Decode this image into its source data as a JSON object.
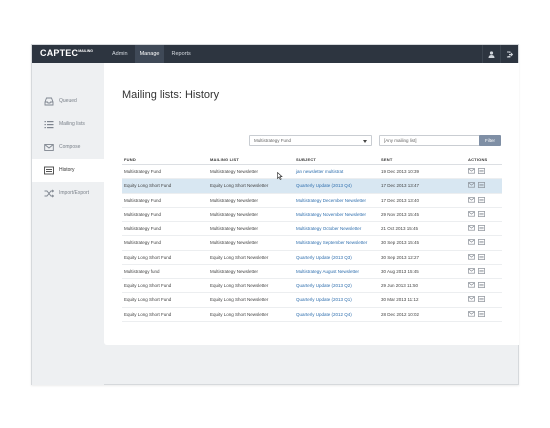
{
  "app": {
    "logo": "CAPTEC",
    "logo_sub": "MAILING"
  },
  "topnav": [
    {
      "label": "Admin",
      "active": false
    },
    {
      "label": "Manage",
      "active": true
    },
    {
      "label": "Reports",
      "active": false
    }
  ],
  "sidebar": {
    "items": [
      {
        "label": "Queued",
        "icon": "inbox-tray-icon",
        "active": false
      },
      {
        "label": "Mailing lists",
        "icon": "list-icon",
        "active": false
      },
      {
        "label": "Compose",
        "icon": "envelope-icon",
        "active": false
      },
      {
        "label": "History",
        "icon": "history-list-icon",
        "active": true
      },
      {
        "label": "Import/Export",
        "icon": "shuffle-icon",
        "active": false
      }
    ]
  },
  "page": {
    "title": "Mailing lists: History"
  },
  "filters": {
    "fund_select": "Multistrategy Fund",
    "list_select": "[Any mailing list]",
    "filter_button": "Filter"
  },
  "table": {
    "headers": {
      "fund": "FUND",
      "list": "MAILING LIST",
      "subject": "SUBJECT",
      "sent": "SENT",
      "actions": "ACTIONS"
    },
    "rows": [
      {
        "fund": "Multistrategy Fund",
        "list": "Multistrategy Newsletter",
        "subject": "jan newsletter multistrat",
        "sent": "19 Dec 2013 10:39"
      },
      {
        "fund": "Equity Long Short Fund",
        "list": "Equity Long Short Newsletter",
        "subject": "Quarterly Update (2013 Q4)",
        "sent": "17 Dec 2013 13:47"
      },
      {
        "fund": "Multistrategy Fund",
        "list": "Multistrategy Newsletter",
        "subject": "Multistrategy December Newsletter",
        "sent": "17 Dec 2013 13:40"
      },
      {
        "fund": "Multistrategy Fund",
        "list": "Multistrategy Newsletter",
        "subject": "Multistrategy November Newsletter",
        "sent": "29 Nov 2013 15:45"
      },
      {
        "fund": "Multistrategy Fund",
        "list": "Multistrategy Newsletter",
        "subject": "Multistrategy October Newsletter",
        "sent": "21 Oct 2013 15:45"
      },
      {
        "fund": "Multistrategy Fund",
        "list": "Multistrategy Newsletter",
        "subject": "Multistrategy September Newsletter",
        "sent": "30 Sep 2013 15:45"
      },
      {
        "fund": "Equity Long Short Fund",
        "list": "Equity Long Short Newsletter",
        "subject": "Quarterly Update (2013 Q3)",
        "sent": "30 Sep 2013 12:27"
      },
      {
        "fund": "Multistrategy fund",
        "list": "Multistrategy Newsletter",
        "subject": "Multistrategy August Newsletter",
        "sent": "30 Aug 2013 15:45"
      },
      {
        "fund": "Equity Long Short Fund",
        "list": "Equity Long Short Newsletter",
        "subject": "Quarterly Update (2013 Q2)",
        "sent": "29 Jun 2013 11:50"
      },
      {
        "fund": "Equity Long Short Fund",
        "list": "Equity Long Short Newsletter",
        "subject": "Quarterly Update (2013 Q1)",
        "sent": "30 Mar 2013 11:12"
      },
      {
        "fund": "Equity Long Short Fund",
        "list": "Equity Long Short Newsletter",
        "subject": "Quarterly Update (2012 Q4)",
        "sent": "28 Dec 2012 10:02"
      }
    ]
  },
  "colors": {
    "topbar": "#2d3540",
    "link": "#2f6fae",
    "highlight": "#d8e7f2",
    "filter_button": "#7f8fa5"
  }
}
